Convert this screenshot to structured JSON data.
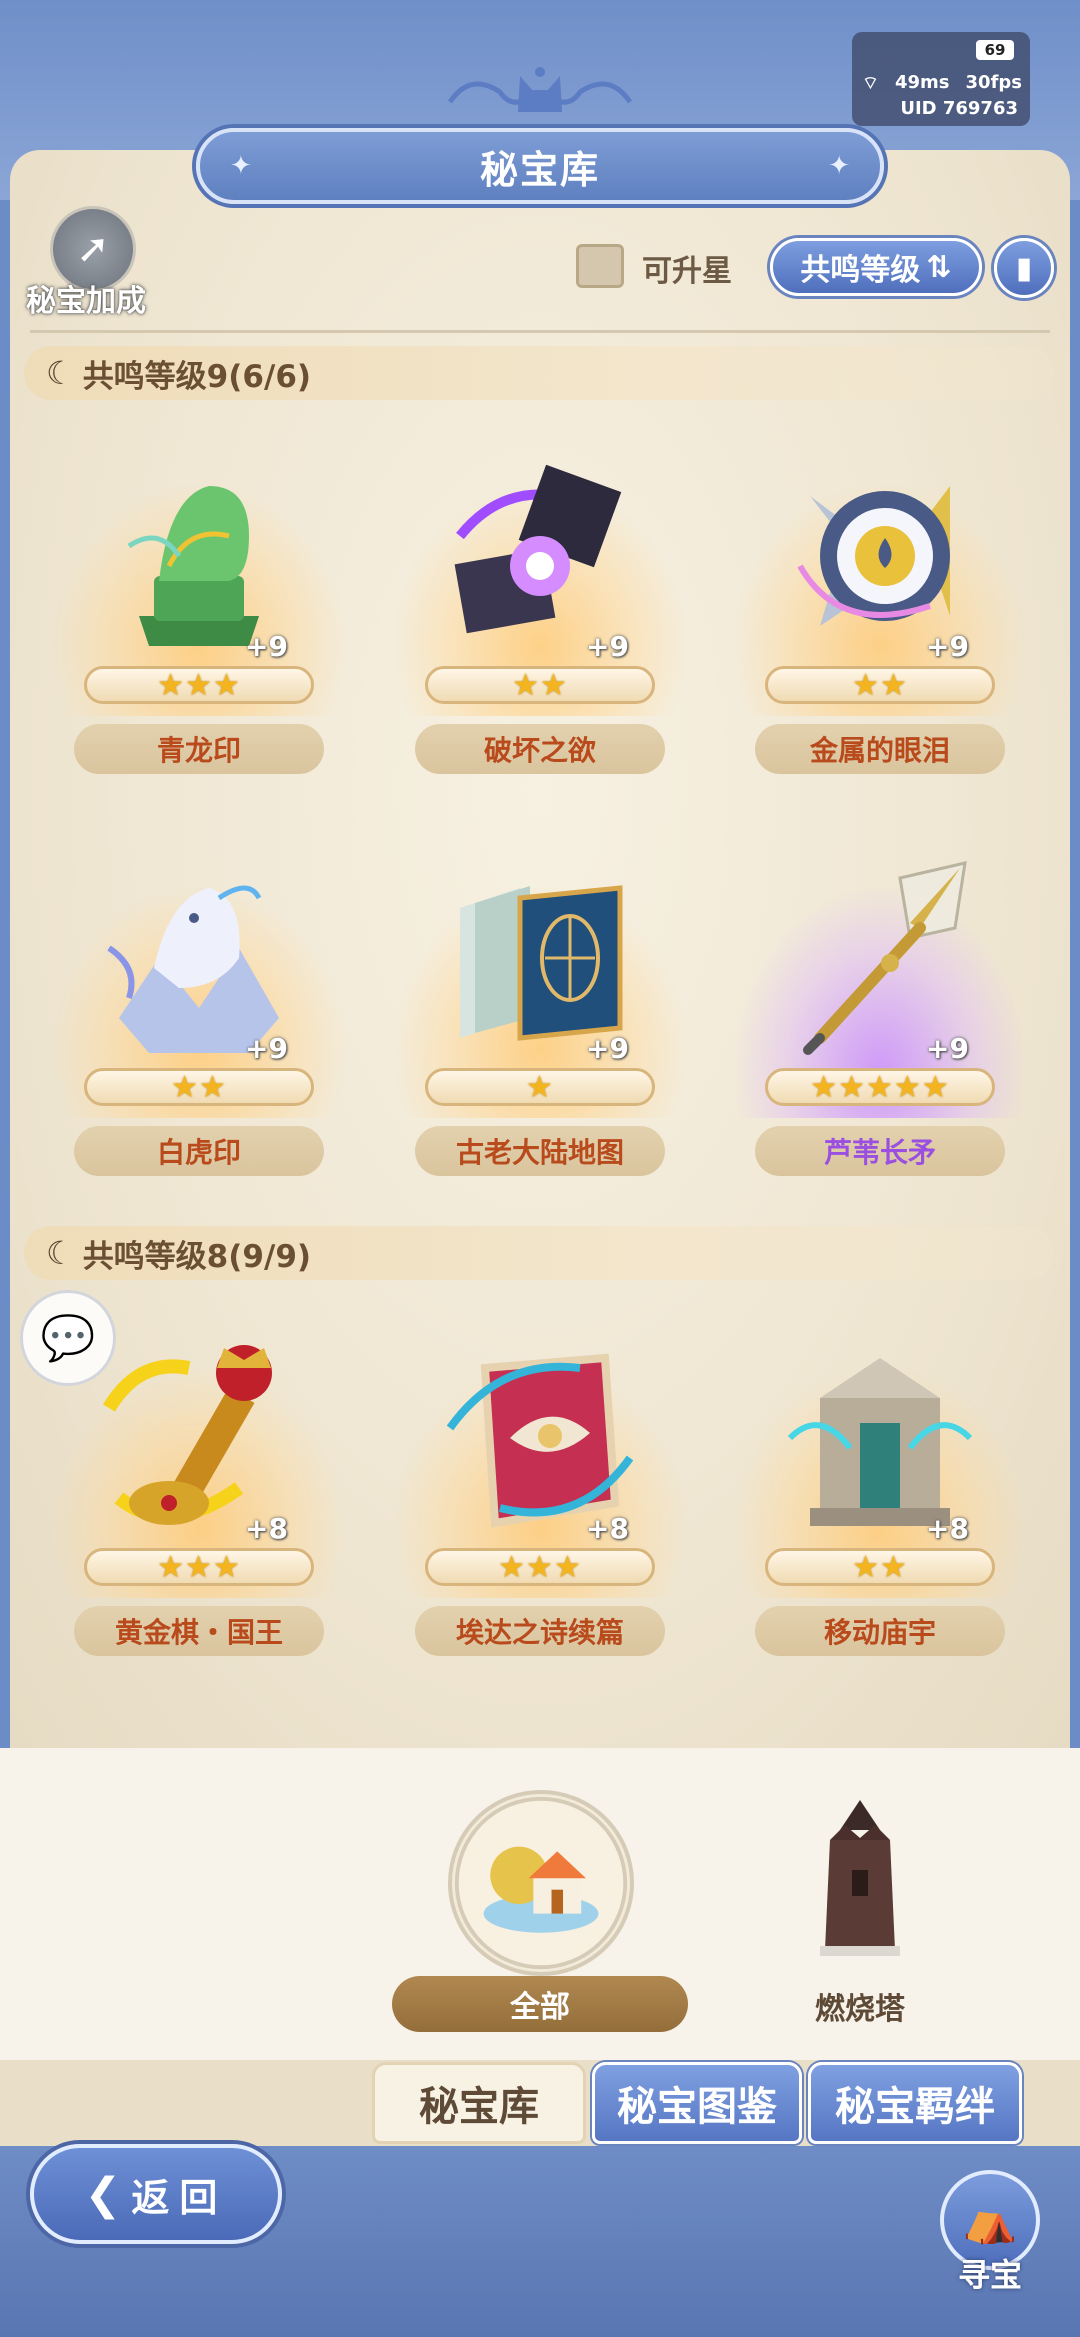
{
  "header": {
    "title": "秘宝库",
    "battery": "69",
    "ping": "49ms",
    "fps": "30fps",
    "uid": "UID 769763"
  },
  "toolbar": {
    "bonus_label": "秘宝加成",
    "upgradable_label": "可升星",
    "upgradable_checked": false,
    "sort_label": "共鸣等级"
  },
  "sections": [
    {
      "header": "共鸣等级9(6/6)",
      "items": [
        {
          "name": "青龙印",
          "stars": "★★★",
          "level": "+9",
          "icon": "jade-dragon-seal-icon"
        },
        {
          "name": "破坏之欲",
          "stars": "★★",
          "level": "+9",
          "icon": "destruction-cube-icon"
        },
        {
          "name": "金属的眼泪",
          "stars": "★★",
          "level": "+9",
          "icon": "metal-teardrop-shield-icon"
        },
        {
          "name": "白虎印",
          "stars": "★★",
          "level": "+9",
          "icon": "white-tiger-seal-icon"
        },
        {
          "name": "古老大陆地图",
          "stars": "★",
          "level": "+9",
          "icon": "ancient-map-book-icon"
        },
        {
          "name": "芦苇长矛",
          "stars": "★★★★★",
          "level": "+9",
          "icon": "reed-spear-icon"
        }
      ]
    },
    {
      "header": "共鸣等级8(9/9)",
      "items": [
        {
          "name": "黄金棋・国王",
          "stars": "★★★",
          "level": "+8",
          "icon": "golden-king-chess-icon"
        },
        {
          "name": "埃达之诗续篇",
          "stars": "★★★",
          "level": "+8",
          "icon": "edda-poem-book-icon"
        },
        {
          "name": "移动庙宇",
          "stars": "★★",
          "level": "+8",
          "icon": "moving-temple-icon"
        }
      ]
    }
  ],
  "filters": {
    "all_label": "全部",
    "tower_label": "燃烧塔"
  },
  "tabs": {
    "vault": "秘宝库",
    "catalog": "秘宝图鉴",
    "bonds": "秘宝羁绊"
  },
  "footer": {
    "back_label": "返回",
    "treasure_label": "寻宝"
  }
}
